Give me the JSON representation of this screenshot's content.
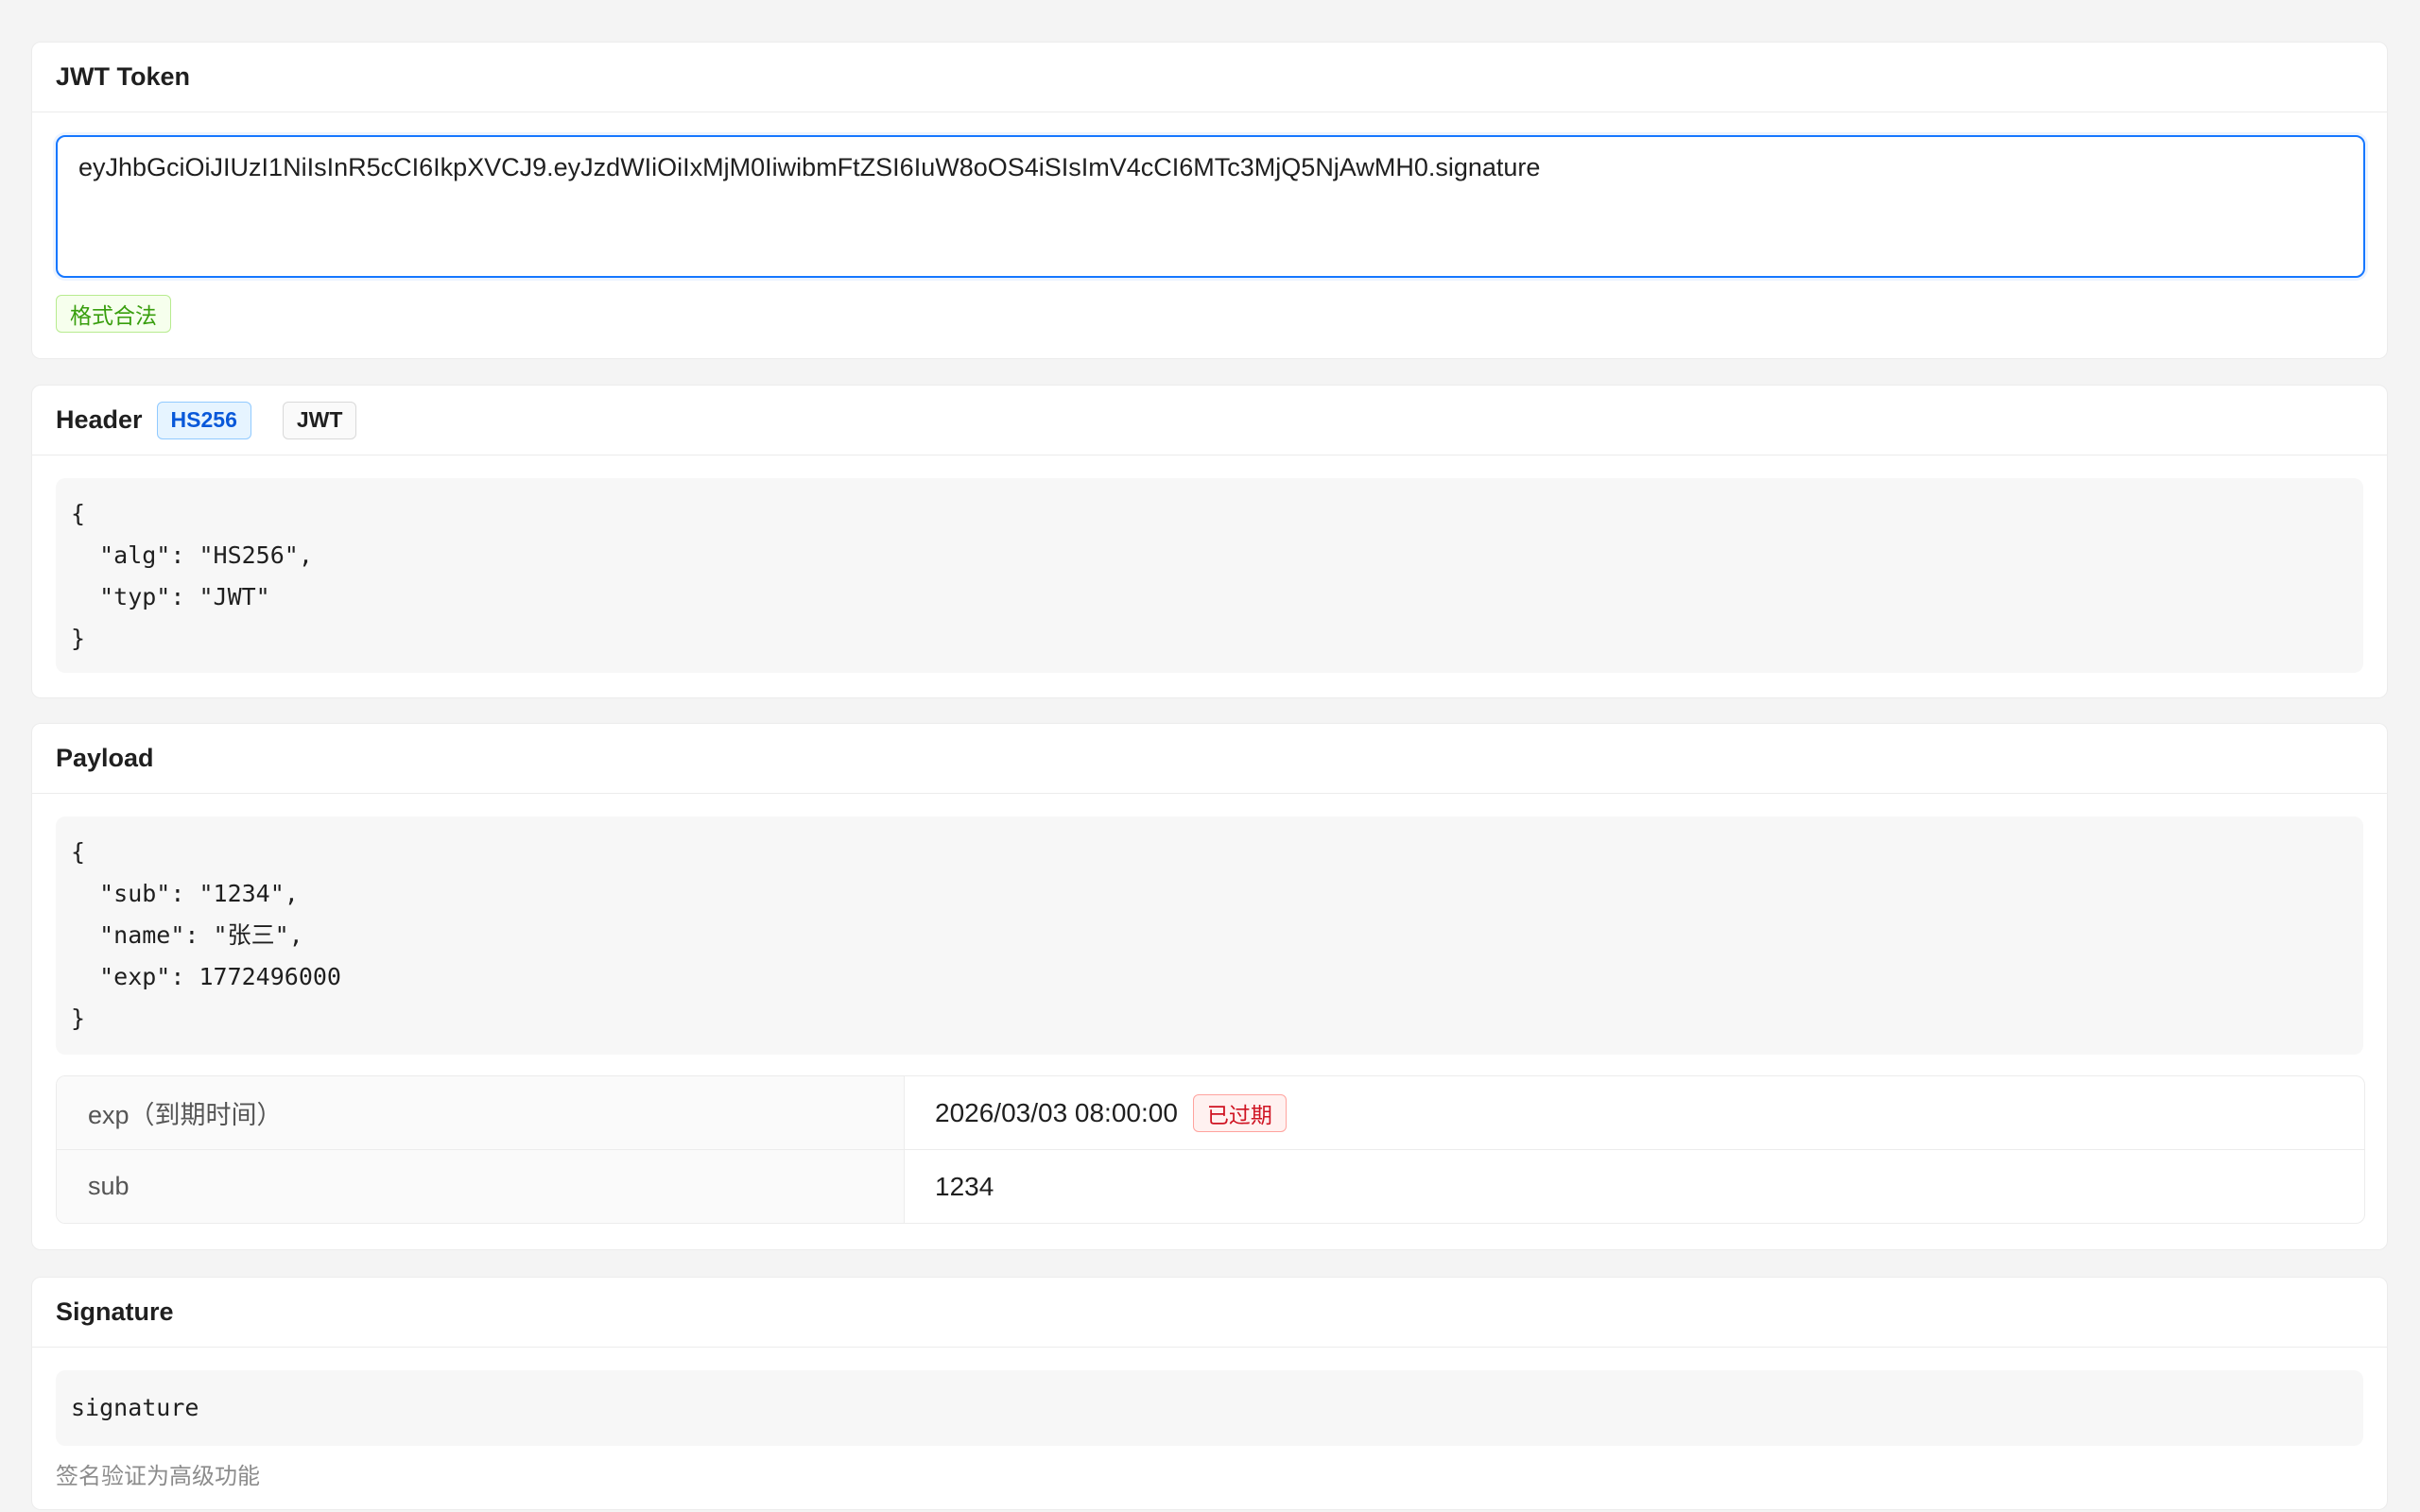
{
  "token_card": {
    "title": "JWT Token",
    "token_value": "eyJhbGciOiJIUzI1NiIsInR5cCI6IkpXVCJ9.eyJzdWIiOiIxMjM0IiwibmFtZSI6IuW8oOS4iSIsImV4cCI6MTc3MjQ5NjAwMH0.signature",
    "status_tag": "格式合法"
  },
  "header_card": {
    "title": "Header",
    "alg_tag": "HS256",
    "typ_tag": "JWT",
    "json": "{\n  \"alg\": \"HS256\",\n  \"typ\": \"JWT\"\n}"
  },
  "payload_card": {
    "title": "Payload",
    "json": "{\n  \"sub\": \"1234\",\n  \"name\": \"张三\",\n  \"exp\": 1772496000\n}",
    "claims": [
      {
        "key": "exp（到期时间）",
        "value": "2026/03/03 08:00:00",
        "tag": "已过期"
      },
      {
        "key": "sub",
        "value": "1234"
      }
    ]
  },
  "signature_card": {
    "title": "Signature",
    "value": "signature",
    "hint": "签名验证为高级功能"
  },
  "colors": {
    "accent": "#1677ff",
    "success": "#389e0d",
    "error": "#cf1322"
  }
}
